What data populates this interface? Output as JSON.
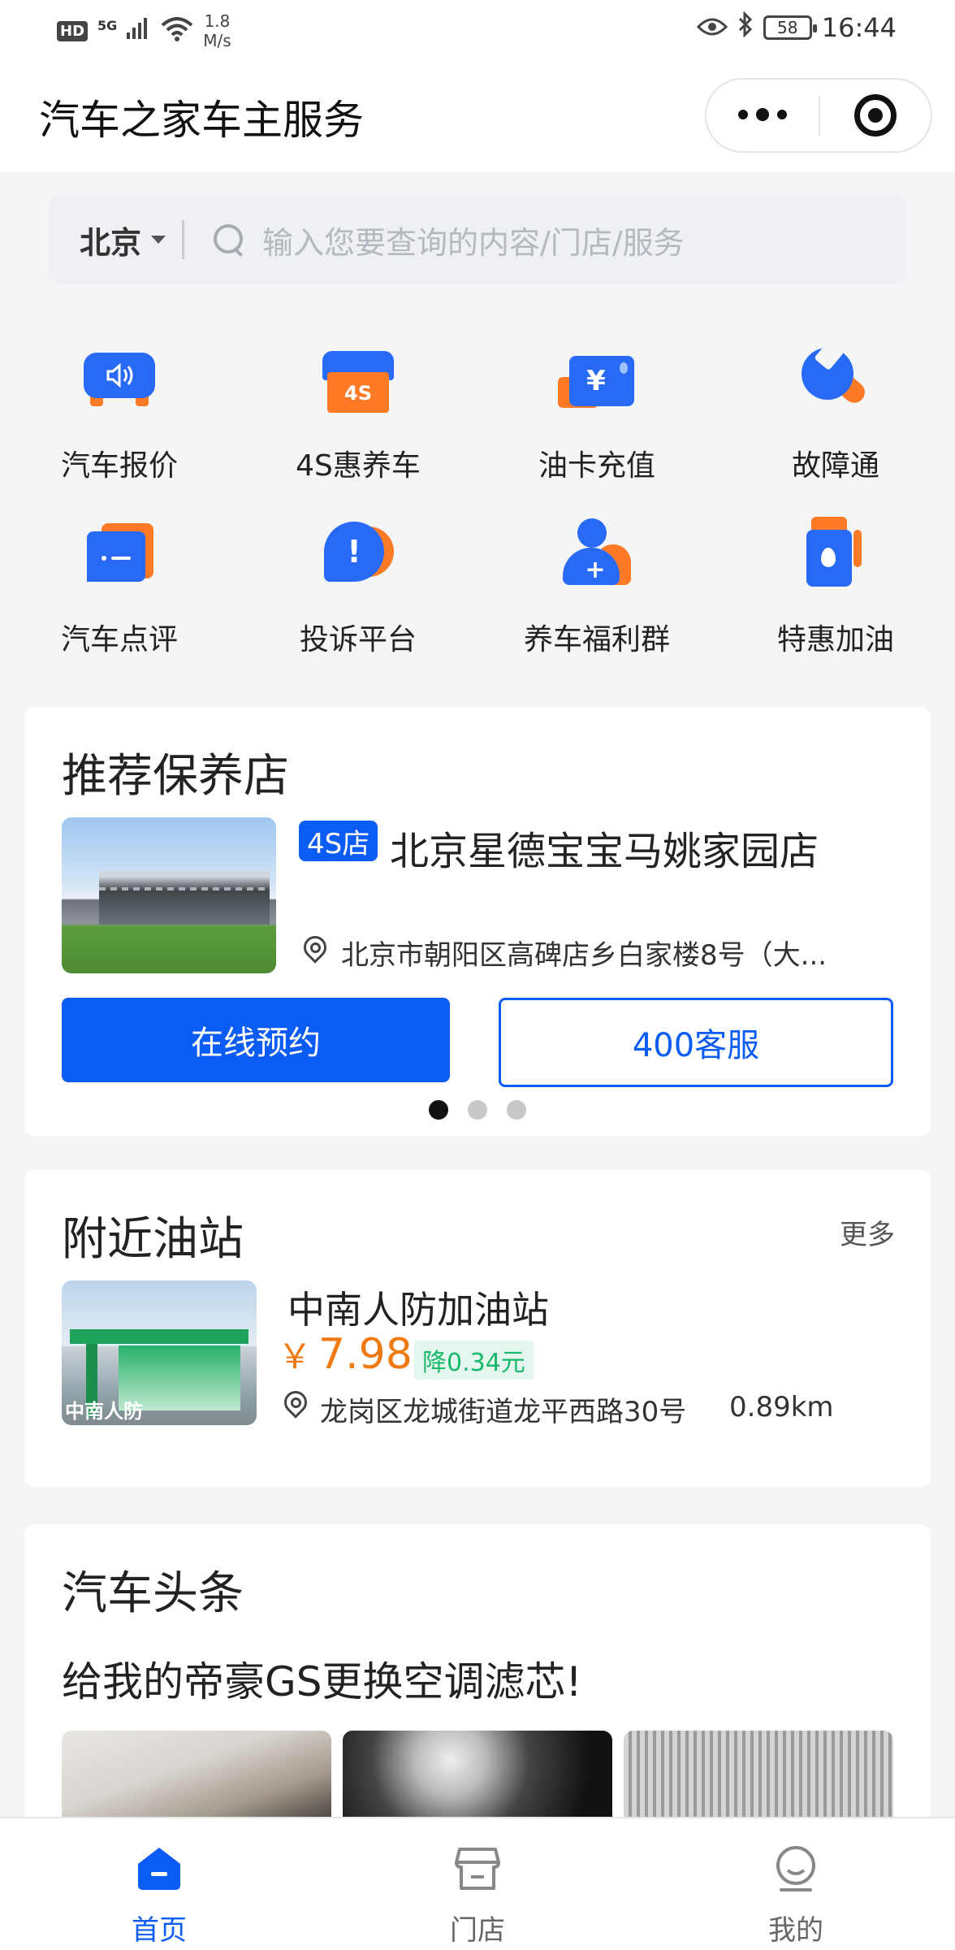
{
  "status_bar": {
    "hd": "HD",
    "network": "5G",
    "speed_value": "1.8",
    "speed_unit": "M/s",
    "battery": "58",
    "time": "16:44"
  },
  "title_bar": {
    "title": "汽车之家车主服务"
  },
  "search": {
    "city": "北京",
    "placeholder": "输入您要查询的内容/门店/服务"
  },
  "services": [
    {
      "label": "汽车报价",
      "icon": "car-price-icon"
    },
    {
      "label": "4S惠养车",
      "icon": "4s-shop-icon"
    },
    {
      "label": "油卡充值",
      "icon": "fuel-card-icon"
    },
    {
      "label": "故障通",
      "icon": "wrench-icon"
    },
    {
      "label": "汽车点评",
      "icon": "comment-icon"
    },
    {
      "label": "投诉平台",
      "icon": "complaint-icon"
    },
    {
      "label": "养车福利群",
      "icon": "group-add-icon"
    },
    {
      "label": "特惠加油",
      "icon": "fuel-pump-icon"
    }
  ],
  "recommended": {
    "title": "推荐保养店",
    "shop": {
      "tag": "4S店",
      "name": "北京星德宝宝马姚家园店",
      "address": "北京市朝阳区高碑店乡白家楼8号（大..."
    },
    "book_button": "在线预约",
    "service_button": "400客服",
    "carousel_total": 3,
    "carousel_active": 1
  },
  "nearby": {
    "title": "附近油站",
    "more": "更多",
    "station": {
      "name": "中南人防加油站",
      "currency": "￥",
      "price": "7.98",
      "discount": "降0.34元",
      "address": "龙岗区龙城街道龙平西路30号",
      "distance": "0.89km",
      "image_text": "中南人防"
    }
  },
  "news": {
    "title": "汽车头条",
    "headline": "给我的帝豪GS更换空调滤芯!"
  },
  "tabs": [
    {
      "label": "首页",
      "icon": "home-icon",
      "active": true
    },
    {
      "label": "门店",
      "icon": "store-icon",
      "active": false
    },
    {
      "label": "我的",
      "icon": "profile-icon",
      "active": false
    }
  ],
  "colors": {
    "primary": "#0b5cf5",
    "icon_blue": "#2869f5",
    "icon_orange": "#ff7a26",
    "price": "#f07a12",
    "discount": "#19b86a"
  }
}
